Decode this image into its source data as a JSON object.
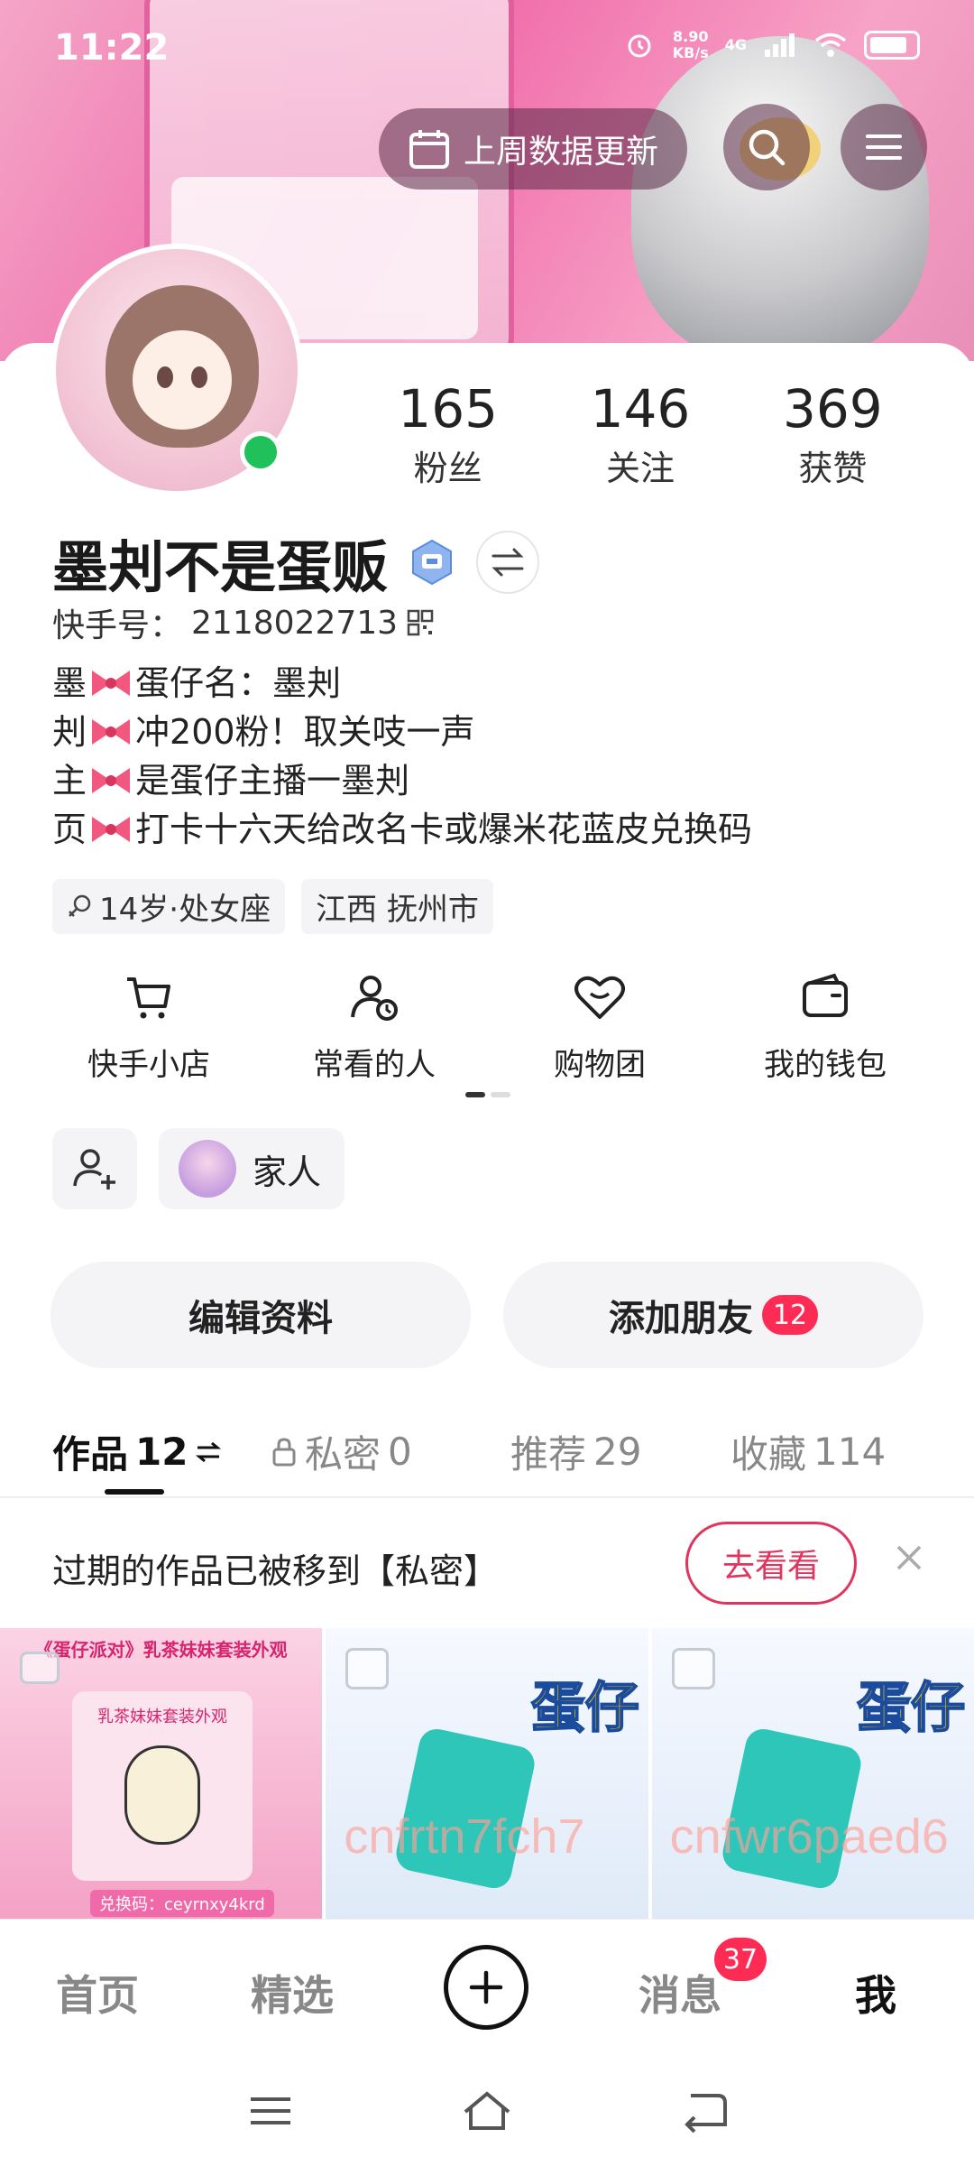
{
  "status_bar": {
    "time": "11:22",
    "net_speed": "8.90",
    "net_unit": "KB/s",
    "network": "4G"
  },
  "header": {
    "weekly_update_label": "上周数据更新"
  },
  "profile": {
    "name": "墨刔不是蛋贩",
    "kuaishou_id_label": "快手号：",
    "kuaishou_id": "2118022713",
    "stats": [
      {
        "value": "165",
        "label": "粉丝"
      },
      {
        "value": "146",
        "label": "关注"
      },
      {
        "value": "369",
        "label": "获赞"
      }
    ],
    "bio_lines": [
      {
        "lead": "墨",
        "text": "蛋仔名：墨刔"
      },
      {
        "lead": "刔",
        "text": "冲200粉！取关吱一声"
      },
      {
        "lead": "主",
        "text": "是蛋仔主播一墨刔"
      },
      {
        "lead": "页",
        "text": "打卡十六天给改名卡或爆米花蓝皮兑换码"
      }
    ],
    "tags": [
      "14岁·处女座",
      "江西 抚州市"
    ]
  },
  "shortcuts": [
    {
      "label": "快手小店",
      "icon": "cart-icon"
    },
    {
      "label": "常看的人",
      "icon": "person-clock-icon"
    },
    {
      "label": "购物团",
      "icon": "heart-icon"
    },
    {
      "label": "我的钱包",
      "icon": "wallet-icon"
    }
  ],
  "family": {
    "label": "家人"
  },
  "actions": {
    "edit_profile": "编辑资料",
    "add_friends": "添加朋友",
    "add_friends_badge": "12"
  },
  "tabs": [
    {
      "label": "作品",
      "count": "12"
    },
    {
      "label": "私密",
      "count": "0"
    },
    {
      "label": "推荐",
      "count": "29"
    },
    {
      "label": "收藏",
      "count": "114"
    }
  ],
  "notice": {
    "text": "过期的作品已被移到【私密】",
    "button": "去看看"
  },
  "thumbnails": {
    "first_title": "《蛋仔派对》乳茶妹妹套装外观",
    "first_card_title": "乳茶妹妹套装外观",
    "first_code": "兑换码：ceyrnxy4krd",
    "second_watermark": "cnfrtn7fch7",
    "third_watermark": "cnfwr6paed6",
    "brand_text": "蛋仔"
  },
  "bottom_nav": {
    "home": "首页",
    "featured": "精选",
    "messages": "消息",
    "messages_badge": "37",
    "me": "我"
  },
  "colors": {
    "accent_red": "#fe2c55",
    "online_green": "#20c05a",
    "notice_red": "#e0355e"
  }
}
